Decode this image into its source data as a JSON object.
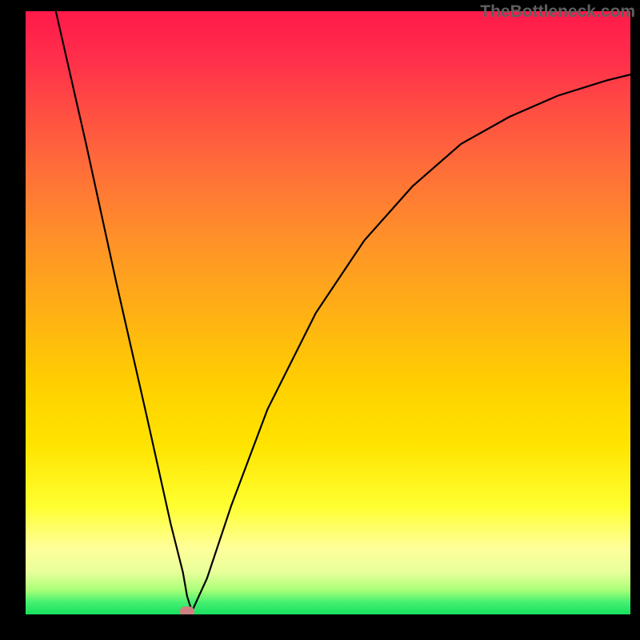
{
  "watermark": "TheBottleneck.com",
  "chart_data": {
    "type": "line",
    "title": "",
    "xlabel": "",
    "ylabel": "",
    "xlim": [
      0,
      100
    ],
    "ylim": [
      0,
      100
    ],
    "series": [
      {
        "name": "bottleneck-curve",
        "x": [
          5,
          10,
          15,
          20,
          22,
          24,
          26,
          26.7,
          27.5,
          30,
          34,
          40,
          48,
          56,
          64,
          72,
          80,
          88,
          96,
          100
        ],
        "y": [
          100,
          78,
          55,
          33,
          24,
          15,
          7,
          3,
          0.5,
          6,
          18,
          34,
          50,
          62,
          71,
          78,
          82.5,
          86,
          88.5,
          89.5
        ]
      }
    ],
    "marker": {
      "x": 26.7,
      "y": 0.5,
      "shape": "pill",
      "color": "#d08080"
    },
    "background": {
      "gradient": [
        "#ff1a4a",
        "#ff8f2a",
        "#ffd000",
        "#ffff30",
        "#18e060"
      ],
      "direction": "top-to-bottom"
    },
    "frame_color": "#000000"
  }
}
